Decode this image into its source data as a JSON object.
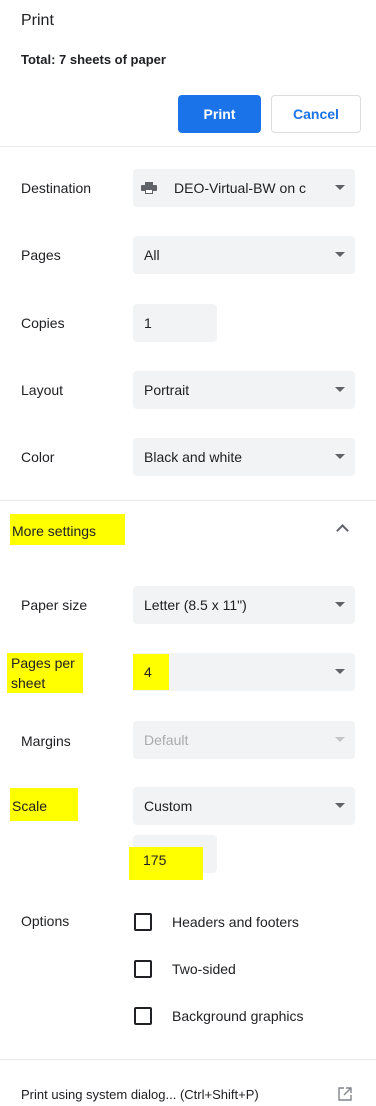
{
  "header": {
    "title": "Print",
    "total": "Total: 7 sheets of paper"
  },
  "buttons": {
    "print": "Print",
    "cancel": "Cancel"
  },
  "settings": {
    "destination": {
      "label": "Destination",
      "value": "DEO-Virtual-BW on c",
      "icon": "printer-icon"
    },
    "pages": {
      "label": "Pages",
      "value": "All"
    },
    "copies": {
      "label": "Copies",
      "value": "1"
    },
    "layout": {
      "label": "Layout",
      "value": "Portrait"
    },
    "color": {
      "label": "Color",
      "value": "Black and white"
    }
  },
  "more_settings": {
    "label": "More settings",
    "expanded": true,
    "icon": "chevron-up-icon"
  },
  "advanced": {
    "paper_size": {
      "label": "Paper size",
      "value": "Letter (8.5 x 11\")"
    },
    "pages_per_sheet": {
      "label_line1": "Pages per",
      "label_line2": "sheet",
      "value": "4"
    },
    "margins": {
      "label": "Margins",
      "value": "Default",
      "disabled": true
    },
    "scale": {
      "label": "Scale",
      "value": "Custom",
      "custom_value": "175"
    },
    "options": {
      "label": "Options",
      "items": [
        {
          "label": "Headers and footers",
          "checked": false
        },
        {
          "label": "Two-sided",
          "checked": false
        },
        {
          "label": "Background graphics",
          "checked": false
        }
      ]
    }
  },
  "footer": {
    "system_dialog": "Print using system dialog... (Ctrl+Shift+P)",
    "icon": "external-link-icon"
  },
  "colors": {
    "accent": "#1a73e8",
    "highlight": "#ffff00",
    "field_bg": "#f1f3f4"
  }
}
